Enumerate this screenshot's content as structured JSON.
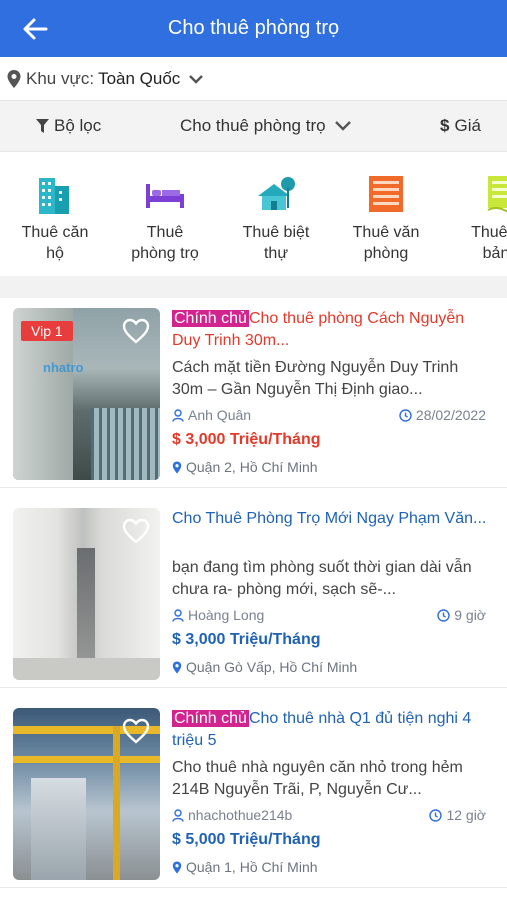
{
  "appbar": {
    "title": "Cho thuê phòng trọ"
  },
  "region": {
    "label": "Khu vực:",
    "value": "Toàn Quốc"
  },
  "filters": {
    "filter_label": "Bộ lọc",
    "category_label": "Cho thuê phòng trọ",
    "price_label": "Giá"
  },
  "categories": [
    {
      "line1": "Thuê căn",
      "line2": "hộ",
      "icon": "apartment-building-icon"
    },
    {
      "line1": "Thuê",
      "line2": "phòng trọ",
      "icon": "bed-icon"
    },
    {
      "line1": "Thuê biệt",
      "line2": "thự",
      "icon": "villa-icon"
    },
    {
      "line1": "Thuê văn",
      "line2": "phòng",
      "icon": "office-building-icon"
    },
    {
      "line1": "Thuê n",
      "line2": "bản",
      "icon": "warehouse-icon"
    }
  ],
  "listings": [
    {
      "badge": "Vip 1",
      "tag": "Chính chủ",
      "title": "Cho thuê phòng Cách Nguyễn Duy Trinh 30m...",
      "desc": "Cách mặt tiền Đường Nguyễn Duy Trinh 30m – Gần Nguyễn Thị Định giao...",
      "author": "Anh Quân",
      "time": "28/02/2022",
      "price": "3,000 Triệu/Tháng",
      "location": "Quận 2, Hồ Chí Minh",
      "watermark": "nhatro"
    },
    {
      "badge": "",
      "tag": "",
      "title": "Cho Thuê Phòng Trọ Mới Ngay Phạm Văn...",
      "desc": "bạn đang tìm phòng suốt thời gian dài vẫn chưa ra- phòng mới, sạch sẽ-...",
      "author": "Hoàng Long",
      "time": "9 giờ",
      "price": "3,000 Triệu/Tháng",
      "location": "Quận Gò Vấp, Hồ Chí Minh",
      "watermark": ""
    },
    {
      "badge": "",
      "tag": "Chính chủ",
      "title": "Cho thuê nhà Q1 đủ tiện nghi 4 triệu 5",
      "desc": "Cho thuê nhà nguyên căn nhỏ trong hẻm 214B Nguyễn Trãi, P, Nguyễn Cư...",
      "author": "nhachothue214b",
      "time": "12 giờ",
      "price": "5,000 Triệu/Tháng",
      "location": "Quận 1, Hồ Chí Minh",
      "watermark": ""
    }
  ],
  "colors": {
    "appbar": "#2f6fe0",
    "title_red": "#e23a2a",
    "title_blue": "#1f62b5",
    "tag": "#d2248f",
    "vip": "#e83d3d"
  }
}
